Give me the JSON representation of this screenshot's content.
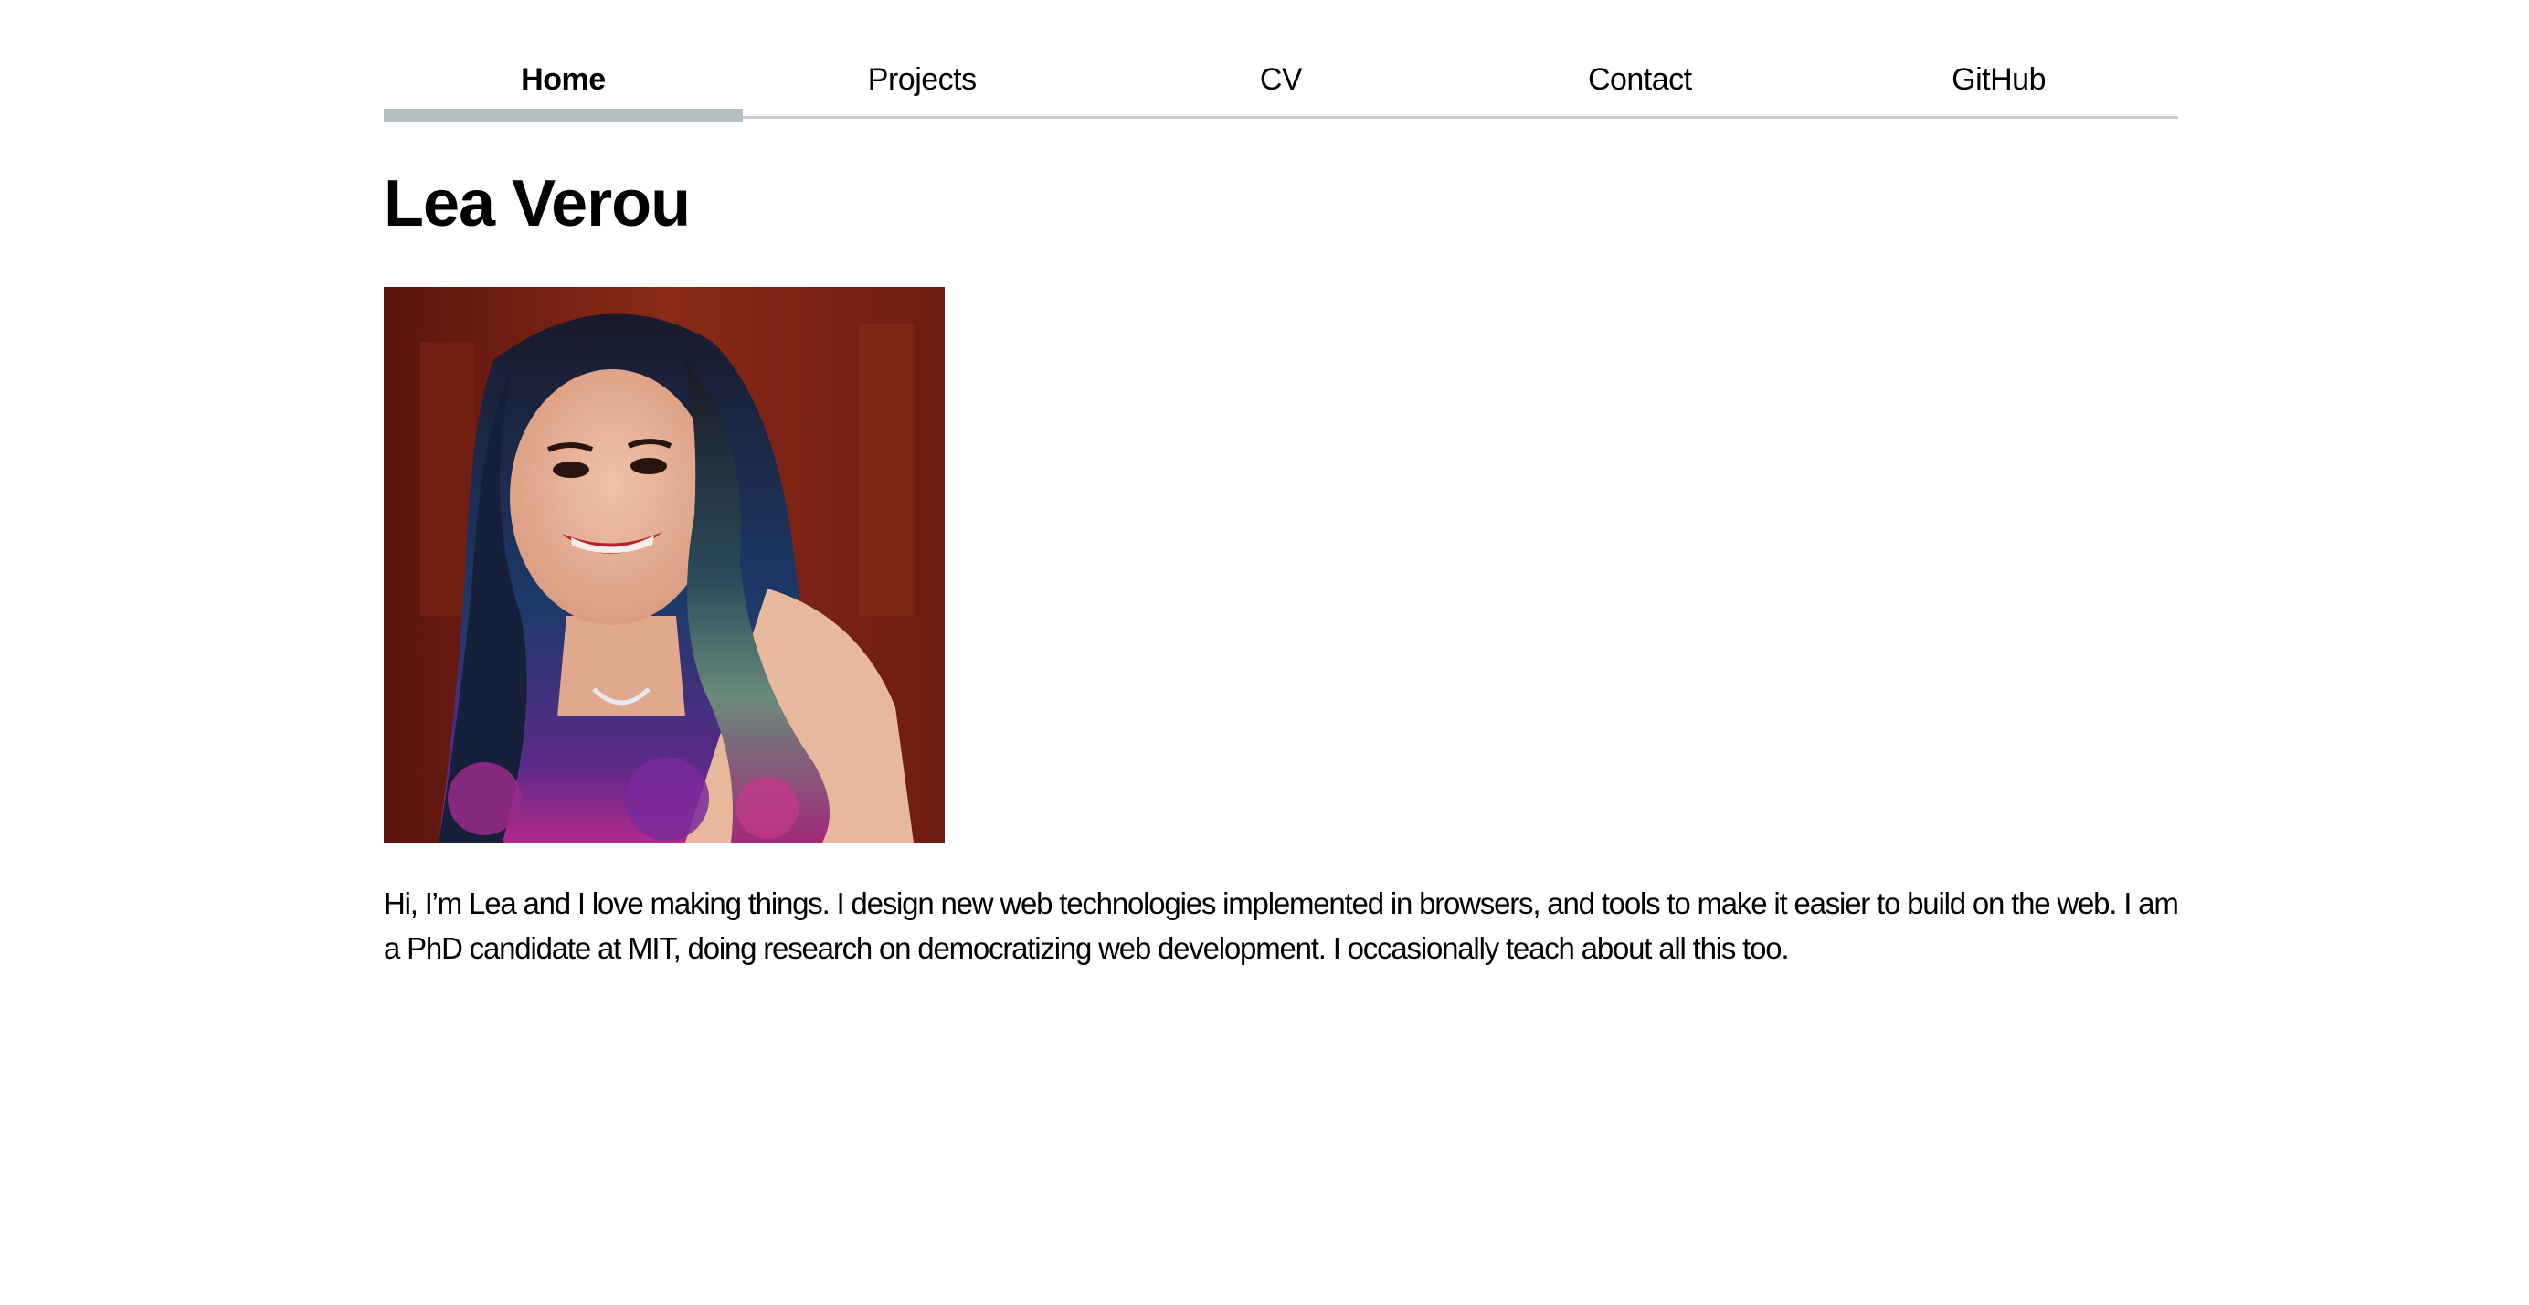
{
  "nav": {
    "items": [
      {
        "label": "Home",
        "active": true
      },
      {
        "label": "Projects",
        "active": false
      },
      {
        "label": "CV",
        "active": false
      },
      {
        "label": "Contact",
        "active": false
      },
      {
        "label": "GitHub",
        "active": false
      }
    ]
  },
  "header": {
    "title": "Lea Verou"
  },
  "main": {
    "bio": "Hi, I’m Lea and I love making things. I design new web technologies implemented in browsers, and tools to make it easier to build on the web. I am a PhD candidate at MIT, doing research on democratizing web development. I occasionally teach about all this too."
  },
  "colors": {
    "active_underline": "#b4bfc1",
    "nav_border": "#c8cdce",
    "text": "#000000",
    "background": "#ffffff"
  }
}
